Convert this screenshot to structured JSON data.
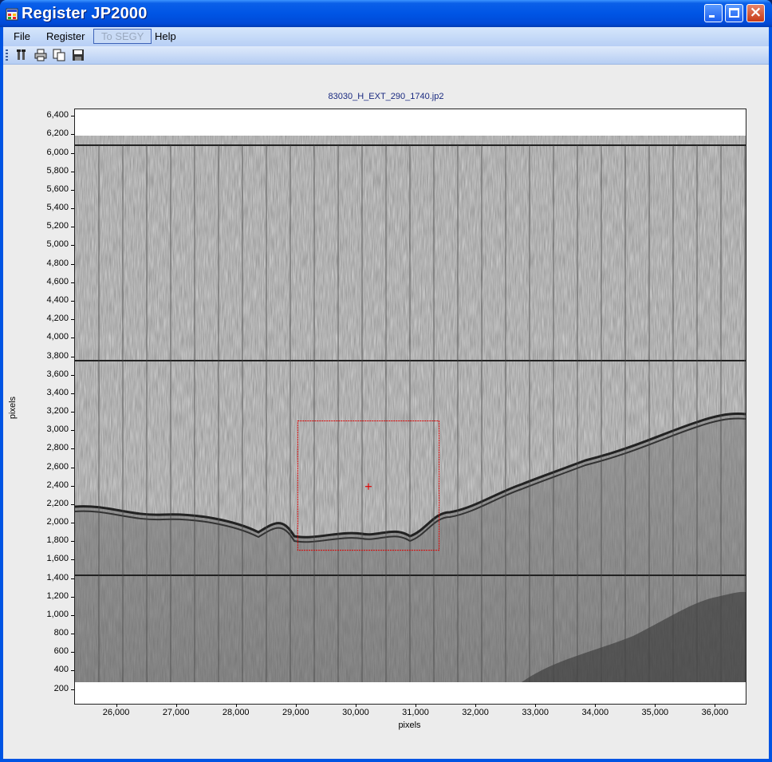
{
  "window": {
    "title": "Register JP2000",
    "accent": "#0054e3"
  },
  "menu": [
    {
      "label": "File",
      "enabled": true
    },
    {
      "label": "Register",
      "enabled": true
    },
    {
      "label": "To SEGY",
      "enabled": false
    },
    {
      "label": "Help",
      "enabled": true
    }
  ],
  "toolbar": {
    "icons": [
      "properties-icon",
      "print-icon",
      "copy-icon",
      "save-icon"
    ]
  },
  "chart_data": {
    "type": "image",
    "title": "83030_H_EXT_290_1740.jp2",
    "xlabel": "pixels",
    "ylabel": "pixels",
    "xlim": [
      25300,
      36500
    ],
    "ylim": [
      50,
      6480
    ],
    "xticks": [
      "26,000",
      "27,000",
      "28,000",
      "29,000",
      "30,000",
      "31,000",
      "32,000",
      "33,000",
      "34,000",
      "35,000",
      "36,000"
    ],
    "yticks": [
      "6,400",
      "6,200",
      "6,000",
      "5,800",
      "5,600",
      "5,400",
      "5,200",
      "5,000",
      "4,800",
      "4,600",
      "4,400",
      "4,200",
      "4,000",
      "3,800",
      "3,600",
      "3,400",
      "3,200",
      "3,000",
      "2,800",
      "2,600",
      "2,400",
      "2,200",
      "2,000",
      "1,800",
      "1,600",
      "1,400",
      "1,200",
      "1,000",
      "800",
      "600",
      "400",
      "200"
    ],
    "selection_box": {
      "x": [
        29020,
        31380
      ],
      "y": [
        1710,
        3110
      ],
      "center": [
        30200,
        2400
      ],
      "color": "#dd0000"
    }
  }
}
